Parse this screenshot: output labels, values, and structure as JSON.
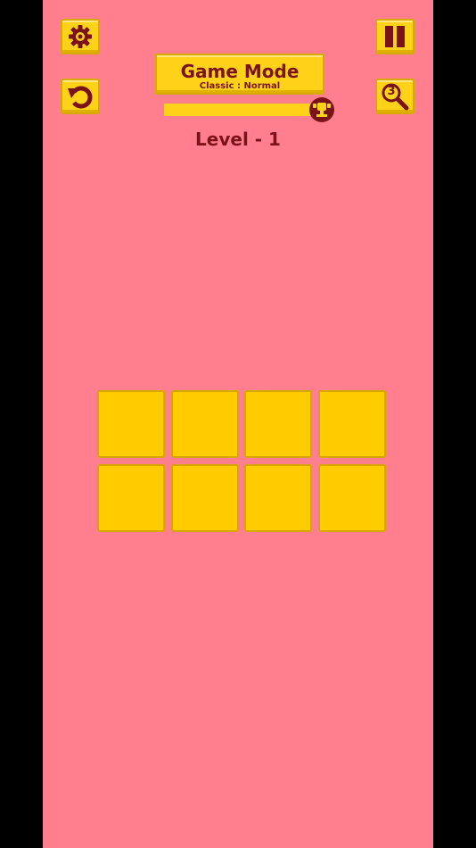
{
  "header": {
    "title": "Game Mode",
    "subtitle": "Classic : Normal"
  },
  "hint_count": "3",
  "progress": {
    "fraction": 1.0
  },
  "level_label": "Level - 1",
  "icons": {
    "settings": "gear-icon",
    "pause": "pause-icon",
    "undo": "undo-icon",
    "hint": "magnifier-icon",
    "trophy": "trophy-icon"
  },
  "board": {
    "rows": 2,
    "cols": 4
  },
  "colors": {
    "background": "#ff7f8e",
    "accent": "#ffd21a",
    "tile": "#ffcc00",
    "text": "#7a1318"
  }
}
